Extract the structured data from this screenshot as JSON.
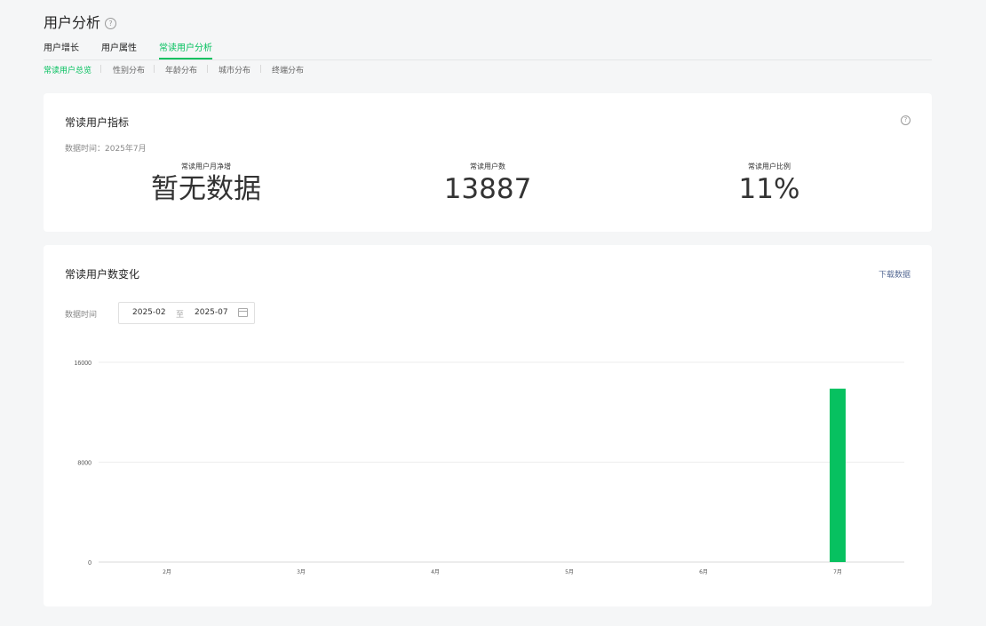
{
  "page": {
    "title": "用户分析",
    "help_icon": "question-circle-icon"
  },
  "tabs": [
    {
      "label": "用户增长"
    },
    {
      "label": "用户属性"
    },
    {
      "label": "常读用户分析"
    }
  ],
  "subtabs": [
    {
      "label": "常读用户总览"
    },
    {
      "label": "性别分布"
    },
    {
      "label": "年龄分布"
    },
    {
      "label": "城市分布"
    },
    {
      "label": "终端分布"
    }
  ],
  "indicators": {
    "title": "常读用户指标",
    "data_time": "数据时间：2025年7月",
    "metrics": [
      {
        "label": "常读用户月净增",
        "value": "暂无数据"
      },
      {
        "label": "常读用户数",
        "value": "13887"
      },
      {
        "label": "常读用户比例",
        "value": "11%"
      }
    ]
  },
  "trend": {
    "title": "常读用户数变化",
    "download_label": "下载数据",
    "date_label": "数据时间",
    "date_start": "2025-02",
    "date_sep": "至",
    "date_end": "2025-07"
  },
  "colors": {
    "accent": "#07c160",
    "link": "#576b95"
  },
  "chart_data": {
    "type": "bar",
    "categories": [
      "2月",
      "3月",
      "4月",
      "5月",
      "6月",
      "7月"
    ],
    "series": [
      {
        "values": [
          0,
          0,
          0,
          0,
          0,
          13887
        ]
      }
    ],
    "yticks": [
      0,
      8000,
      16000
    ],
    "ylim": [
      0,
      16000
    ],
    "grid": true,
    "color": "#07c160"
  }
}
